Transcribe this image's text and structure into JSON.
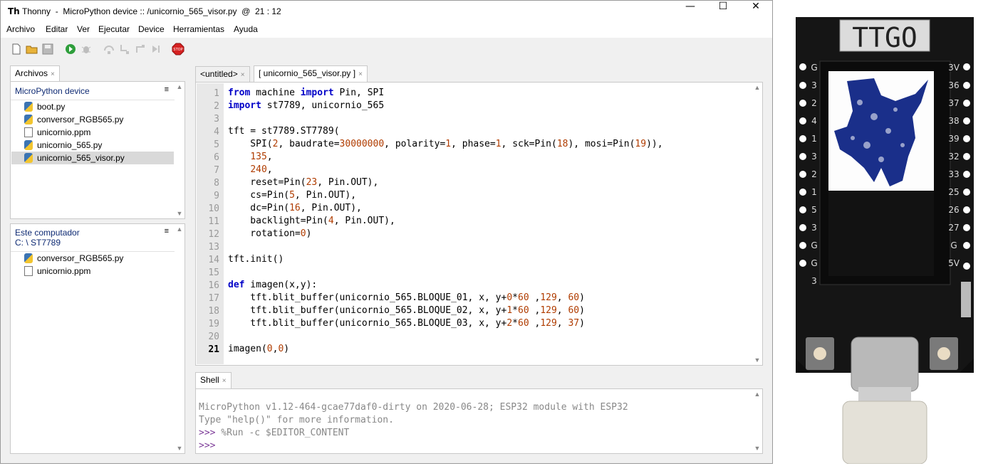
{
  "window": {
    "title": "Thonny  -  MicroPython device :: /unicornio_565_visor.py  @  21 : 12",
    "app_icon": "thonny-logo-icon",
    "minimize": "—",
    "maximize": "☐",
    "close": "✕"
  },
  "menu": [
    "Archivo",
    "Editar",
    "Ver",
    "Ejecutar",
    "Device",
    "Herramientas",
    "Ayuda"
  ],
  "toolbar": {
    "icons": [
      "new-file-icon",
      "open-file-icon",
      "save-icon",
      "run-icon",
      "debug-icon",
      "step-over-icon",
      "step-into-icon",
      "step-out-icon",
      "resume-icon",
      "stop-icon"
    ],
    "stop_label": "STOP"
  },
  "files_panel": {
    "tab": "Archivos",
    "device_header": "MicroPython device",
    "device_files": [
      {
        "name": "boot.py",
        "type": "py"
      },
      {
        "name": "conversor_RGB565.py",
        "type": "py"
      },
      {
        "name": "unicornio.ppm",
        "type": "file"
      },
      {
        "name": "unicornio_565.py",
        "type": "py"
      },
      {
        "name": "unicornio_565_visor.py",
        "type": "py",
        "selected": true
      }
    ],
    "computer_header": "Este computador",
    "computer_path": "C: \\ ST7789",
    "computer_files": [
      {
        "name": "conversor_RGB565.py",
        "type": "py"
      },
      {
        "name": "unicornio.ppm",
        "type": "file"
      }
    ],
    "menu_glyph": "≡"
  },
  "editor": {
    "tabs": [
      "<untitled>",
      "[ unicornio_565_visor.py ]"
    ],
    "tab_close": "×",
    "current_line": 21,
    "lines": [
      "from machine import Pin, SPI",
      "import st7789, unicornio_565",
      "",
      "tft = st7789.ST7789(",
      "    SPI(2, baudrate=30000000, polarity=1, phase=1, sck=Pin(18), mosi=Pin(19)),",
      "    135,",
      "    240,",
      "    reset=Pin(23, Pin.OUT),",
      "    cs=Pin(5, Pin.OUT),",
      "    dc=Pin(16, Pin.OUT),",
      "    backlight=Pin(4, Pin.OUT),",
      "    rotation=0)",
      "",
      "tft.init()",
      "",
      "def imagen(x,y):",
      "    tft.blit_buffer(unicornio_565.BLOQUE_01, x, y+0*60 ,129, 60)",
      "    tft.blit_buffer(unicornio_565.BLOQUE_02, x, y+1*60 ,129, 60)",
      "    tft.blit_buffer(unicornio_565.BLOQUE_03, x, y+2*60 ,129, 37)",
      "",
      "imagen(0,0)"
    ]
  },
  "shell": {
    "tab": "Shell",
    "lines": [
      {
        "prompt": "",
        "text": "MicroPython v1.12-464-gcae77daf0-dirty on 2020-06-28; ESP32 module with ESP32"
      },
      {
        "prompt": "",
        "text": "Type \"help()\" for more information."
      },
      {
        "prompt": ">>>",
        "text": " %Run -c $EDITOR_CONTENT"
      },
      {
        "prompt": ">>>",
        "text": ""
      }
    ]
  },
  "photo": {
    "board_label": "TTGO",
    "pins_left": [
      "G",
      "3",
      "2",
      "4",
      "1",
      "3",
      "2",
      "1",
      "5",
      "3",
      "G",
      "G",
      "3"
    ],
    "pins_right": [
      "3V",
      "36",
      "37",
      "38",
      "39",
      "32",
      "33",
      "25",
      "26",
      "27",
      "G",
      "5V"
    ],
    "colors": {
      "board": "#151515",
      "screen_image": "#1a2f8a",
      "screen_bg": "#ffffff"
    }
  }
}
